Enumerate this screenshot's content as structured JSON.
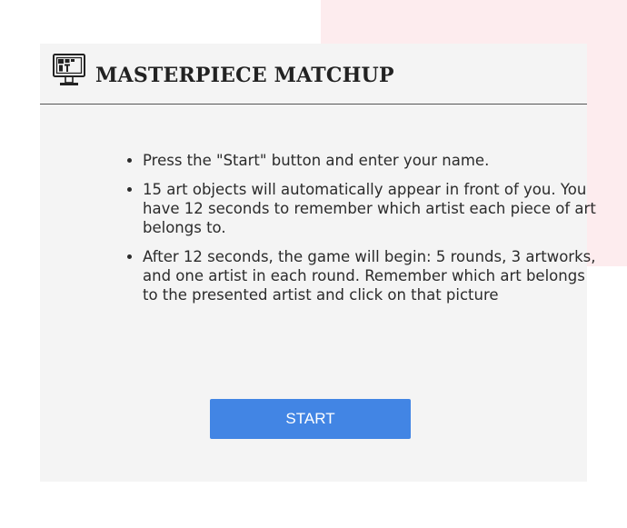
{
  "header": {
    "logo_icon": "computer-monitor-art-icon",
    "title": "MASTERPIECE MATCHUP"
  },
  "rules": [
    "Press the \"Start\" button and enter your name.",
    "15 art objects will automatically appear in front of you. You have 12 seconds to remember which artist each piece of art belongs to.",
    "After 12 seconds, the game will begin: 5 rounds, 3 artworks, and one artist in each round. Remember which art belongs to the presented artist and click on that picture"
  ],
  "start_button": {
    "label": "START"
  },
  "colors": {
    "accent": "#4285e4",
    "panel_background": "#f4f4f4",
    "decor_pink": "#fdecee"
  }
}
